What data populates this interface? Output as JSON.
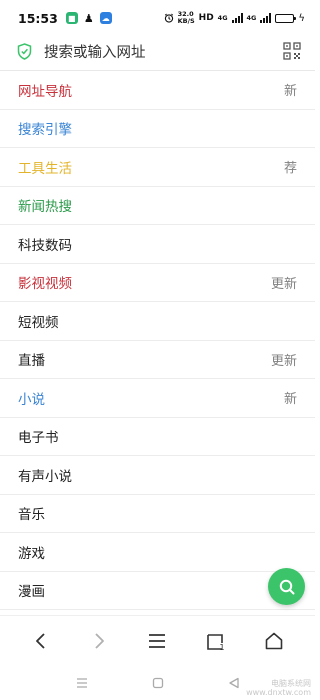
{
  "status_bar": {
    "time": "15:53",
    "speed_value": "32.0",
    "speed_unit": "KB/S",
    "hd": "HD",
    "net1": "4G",
    "net2": "4G",
    "battery_level": 0.8
  },
  "search": {
    "placeholder": "搜索或输入网址"
  },
  "list": [
    {
      "label": "网址导航",
      "color": "#c8323c",
      "badge": "新"
    },
    {
      "label": "搜索引擎",
      "color": "#3a84d4",
      "badge": ""
    },
    {
      "label": "工具生活",
      "color": "#e3b42a",
      "badge": "荐"
    },
    {
      "label": "新闻热搜",
      "color": "#2a9a4a",
      "badge": ""
    },
    {
      "label": "科技数码",
      "color": "#222222",
      "badge": ""
    },
    {
      "label": "影视视频",
      "color": "#c8323c",
      "badge": "更新"
    },
    {
      "label": "短视频",
      "color": "#222222",
      "badge": ""
    },
    {
      "label": "直播",
      "color": "#222222",
      "badge": "更新"
    },
    {
      "label": "小说",
      "color": "#3a84d4",
      "badge": "新"
    },
    {
      "label": "电子书",
      "color": "#222222",
      "badge": ""
    },
    {
      "label": "有声小说",
      "color": "#222222",
      "badge": ""
    },
    {
      "label": "音乐",
      "color": "#222222",
      "badge": ""
    },
    {
      "label": "游戏",
      "color": "#222222",
      "badge": ""
    },
    {
      "label": "漫画",
      "color": "#222222",
      "badge": ""
    }
  ],
  "bottom_nav": {
    "tabs_count": "1"
  },
  "colors": {
    "fab": "#3cc46a",
    "shield": "#3cc46a"
  },
  "icons": {
    "search_left": "shield-icon",
    "search_right": "qr-scan-icon",
    "fab": "search-icon",
    "nav": [
      "back-icon",
      "forward-icon",
      "menu-icon",
      "tabs-icon",
      "home-icon"
    ],
    "system": [
      "recents-icon",
      "home-square-icon",
      "back-triangle-icon"
    ]
  },
  "watermark": {
    "line1": "电脑系统网",
    "line2": "www.dnxtw.com"
  }
}
